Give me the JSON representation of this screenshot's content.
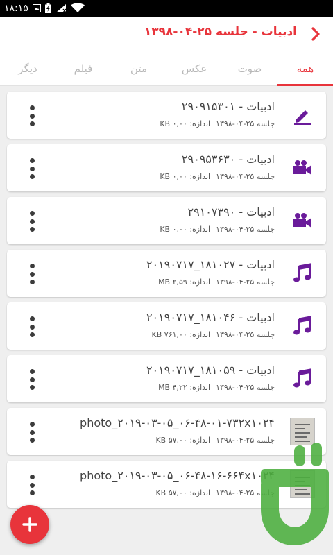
{
  "statusbar": {
    "time": "۱۸:۱۵"
  },
  "header": {
    "title": "ادبیات - جلسه ۲۵-۰۴-۱۳۹۸"
  },
  "tabs": [
    {
      "label": "همه",
      "active": true
    },
    {
      "label": "صوت",
      "active": false
    },
    {
      "label": "عکس",
      "active": false
    },
    {
      "label": "متن",
      "active": false
    },
    {
      "label": "فیلم",
      "active": false
    },
    {
      "label": "دیگر",
      "active": false
    }
  ],
  "files": [
    {
      "name": "ادبیات - ۲۹۰۹۱۵۳۰۱",
      "session": "جلسه ۲۵-۰۴-۱۳۹۸",
      "size_label": "اندازه: ۰,۰۰ KB",
      "icon": "edit-icon"
    },
    {
      "name": "ادبیات - ۲۹۰۹۵۳۶۳۰",
      "session": "جلسه ۲۵-۰۴-۱۳۹۸",
      "size_label": "اندازه: ۰,۰۰ KB",
      "icon": "video-camera-icon"
    },
    {
      "name": "ادبیات - ۲۹۱۰۷۳۹۰",
      "session": "جلسه ۲۵-۰۴-۱۳۹۸",
      "size_label": "اندازه: ۰,۰۰ KB",
      "icon": "video-camera-icon"
    },
    {
      "name": "ادبیات - ۱۸۱۰۲۷_۲۰۱۹۰۷۱۷",
      "session": "جلسه ۲۵-۰۴-۱۳۹۸",
      "size_label": "اندازه: ۲,۵۹ MB",
      "icon": "music-note-icon"
    },
    {
      "name": "ادبیات - ۱۸۱۰۴۶_۲۰۱۹۰۷۱۷",
      "session": "جلسه ۲۵-۰۴-۱۳۹۸",
      "size_label": "اندازه: ۷۶۱,۰۰ KB",
      "icon": "music-note-icon"
    },
    {
      "name": "ادبیات - ۱۸۱۰۵۹_۲۰۱۹۰۷۱۷",
      "session": "جلسه ۲۵-۰۴-۱۳۹۸",
      "size_label": "اندازه: ۴,۲۲ MB",
      "icon": "music-note-icon"
    },
    {
      "name": "photo_۲۰۱۹-۰۳-۰۵_۰۶-۴۸-۰۱-۷۳۲x۱۰۲۴",
      "session": "جلسه ۲۵-۰۴-۱۳۹۸",
      "size_label": "اندازه: ۵۷,۰۰ KB",
      "icon": "photo-thumbnail"
    },
    {
      "name": "photo_۲۰۱۹-۰۳-۰۵_۰۶-۴۸-۱۶-۶۶۴x۱۰۲۴",
      "session": "جلسه ۲۵-۰۴-۱۳۹۸",
      "size_label": "اندازه: ۵۷,۰۰ KB",
      "icon": "photo-thumbnail"
    }
  ],
  "colors": {
    "accent": "#e8343b",
    "icon_purple": "#6a1b9a",
    "watermark_green": "#4caf3e"
  }
}
